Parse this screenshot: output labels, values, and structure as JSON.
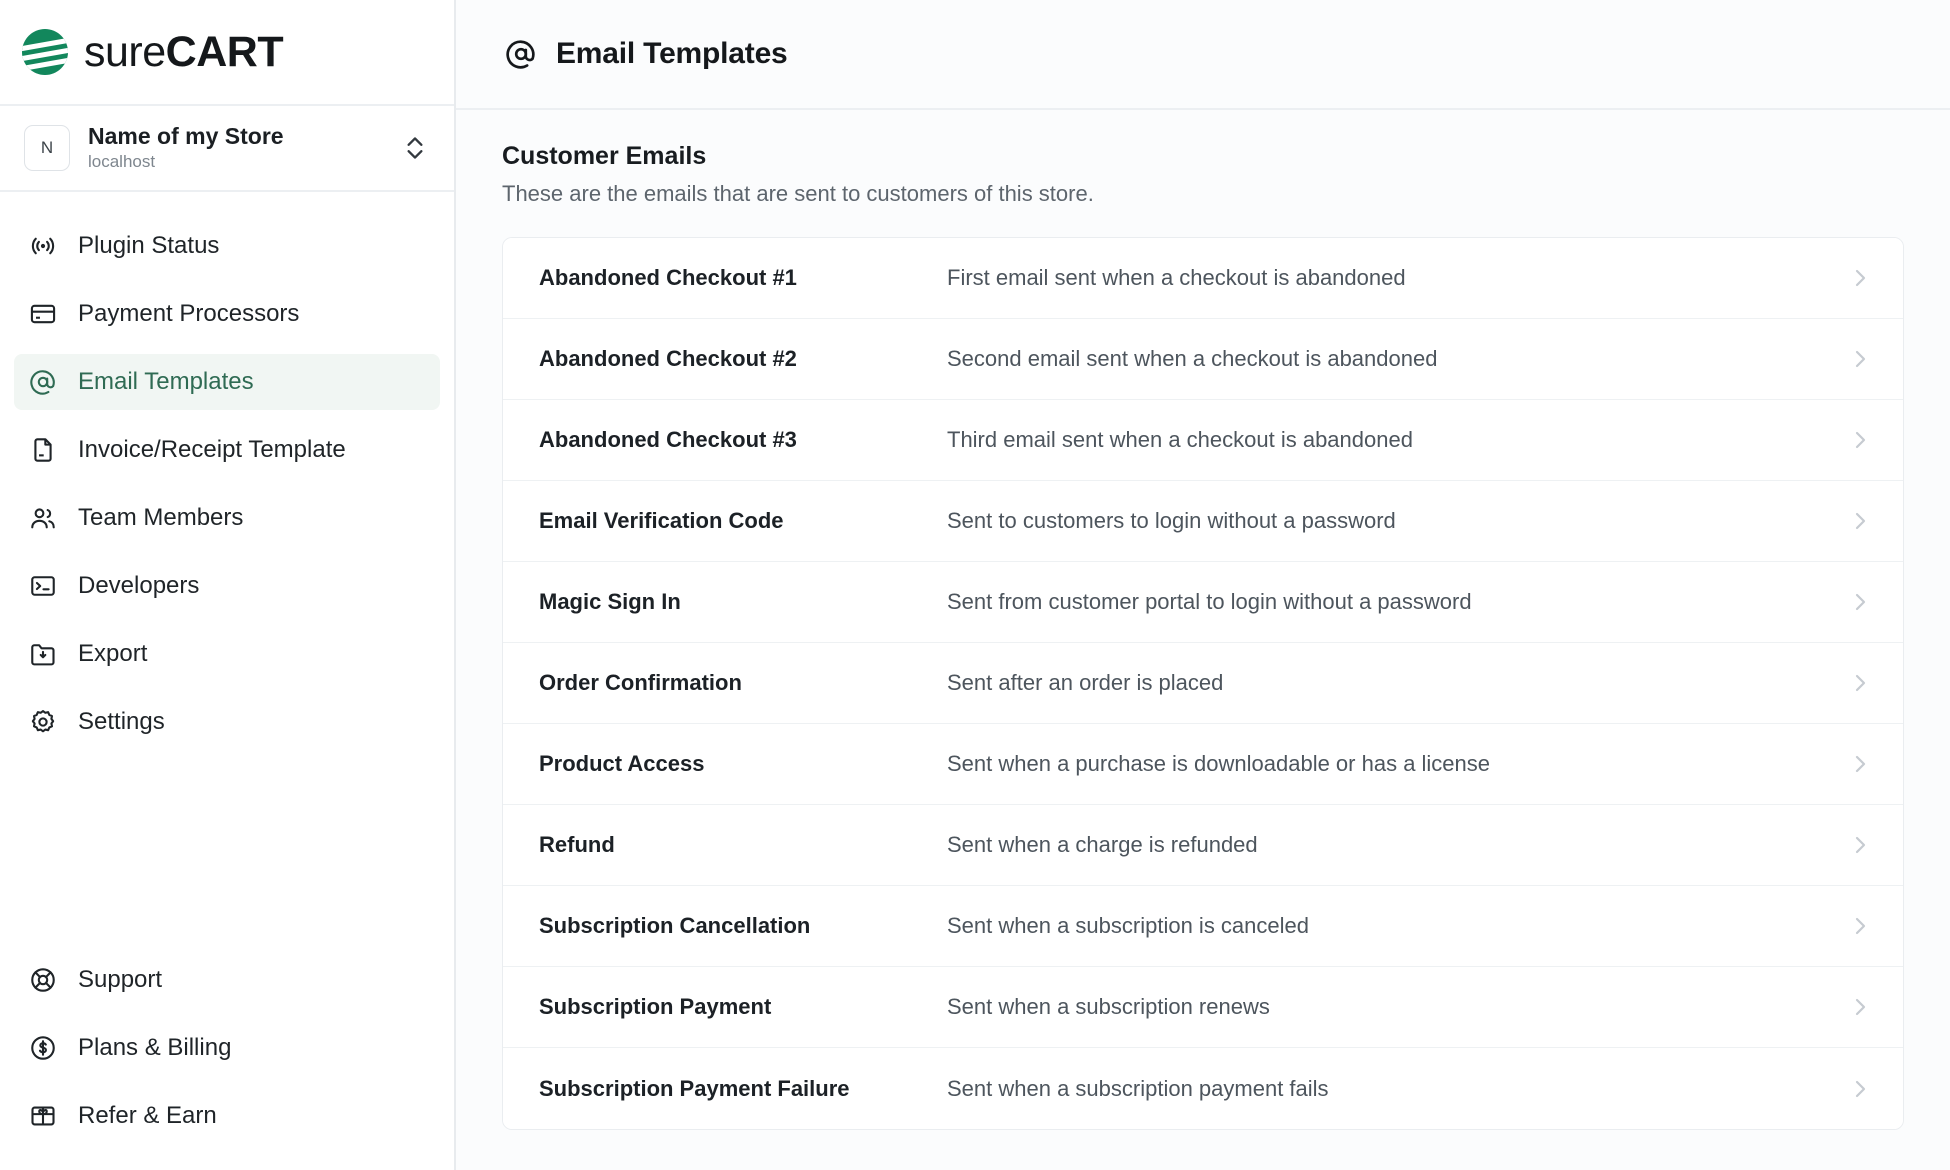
{
  "brand": {
    "logo_icon": "surecart-logo-icon",
    "name_light": "sure",
    "name_bold": "CART",
    "accent_color": "#12875c",
    "active_color": "#2f6b53"
  },
  "store_selector": {
    "avatar_initial": "N",
    "name": "Name of my Store",
    "host": "localhost",
    "caret_icon": "chevron-up-down-icon"
  },
  "sidebar": {
    "items": [
      {
        "label": "Plugin Status",
        "icon": "broadcast-icon",
        "active": false
      },
      {
        "label": "Payment Processors",
        "icon": "credit-card-icon",
        "active": false
      },
      {
        "label": "Email Templates",
        "icon": "at-sign-icon",
        "active": true
      },
      {
        "label": "Invoice/Receipt Template",
        "icon": "document-icon",
        "active": false
      },
      {
        "label": "Team Members",
        "icon": "users-icon",
        "active": false
      },
      {
        "label": "Developers",
        "icon": "terminal-icon",
        "active": false
      },
      {
        "label": "Export",
        "icon": "folder-download-icon",
        "active": false
      },
      {
        "label": "Settings",
        "icon": "gear-icon",
        "active": false
      }
    ],
    "bottom_items": [
      {
        "label": "Support",
        "icon": "lifebuoy-icon"
      },
      {
        "label": "Plans & Billing",
        "icon": "dollar-circle-icon"
      },
      {
        "label": "Refer & Earn",
        "icon": "gift-icon"
      }
    ]
  },
  "header": {
    "icon": "at-sign-icon",
    "title": "Email Templates"
  },
  "main": {
    "section_title": "Customer Emails",
    "section_description": "These are the emails that are sent to customers of this store.",
    "rows": [
      {
        "title": "Abandoned Checkout #1",
        "description": "First email sent when a checkout is abandoned"
      },
      {
        "title": "Abandoned Checkout #2",
        "description": "Second email sent when a checkout is abandoned"
      },
      {
        "title": "Abandoned Checkout #3",
        "description": "Third email sent when a checkout is abandoned"
      },
      {
        "title": "Email Verification Code",
        "description": "Sent to customers to login without a password"
      },
      {
        "title": "Magic Sign In",
        "description": "Sent from customer portal to login without a password"
      },
      {
        "title": "Order Confirmation",
        "description": "Sent after an order is placed"
      },
      {
        "title": "Product Access",
        "description": "Sent when a purchase is downloadable or has a license"
      },
      {
        "title": "Refund",
        "description": "Sent when a charge is refunded"
      },
      {
        "title": "Subscription Cancellation",
        "description": "Sent when a subscription is canceled"
      },
      {
        "title": "Subscription Payment",
        "description": "Sent when a subscription renews"
      },
      {
        "title": "Subscription Payment Failure",
        "description": "Sent when a subscription payment fails"
      }
    ],
    "row_chevron_icon": "chevron-right-icon"
  }
}
